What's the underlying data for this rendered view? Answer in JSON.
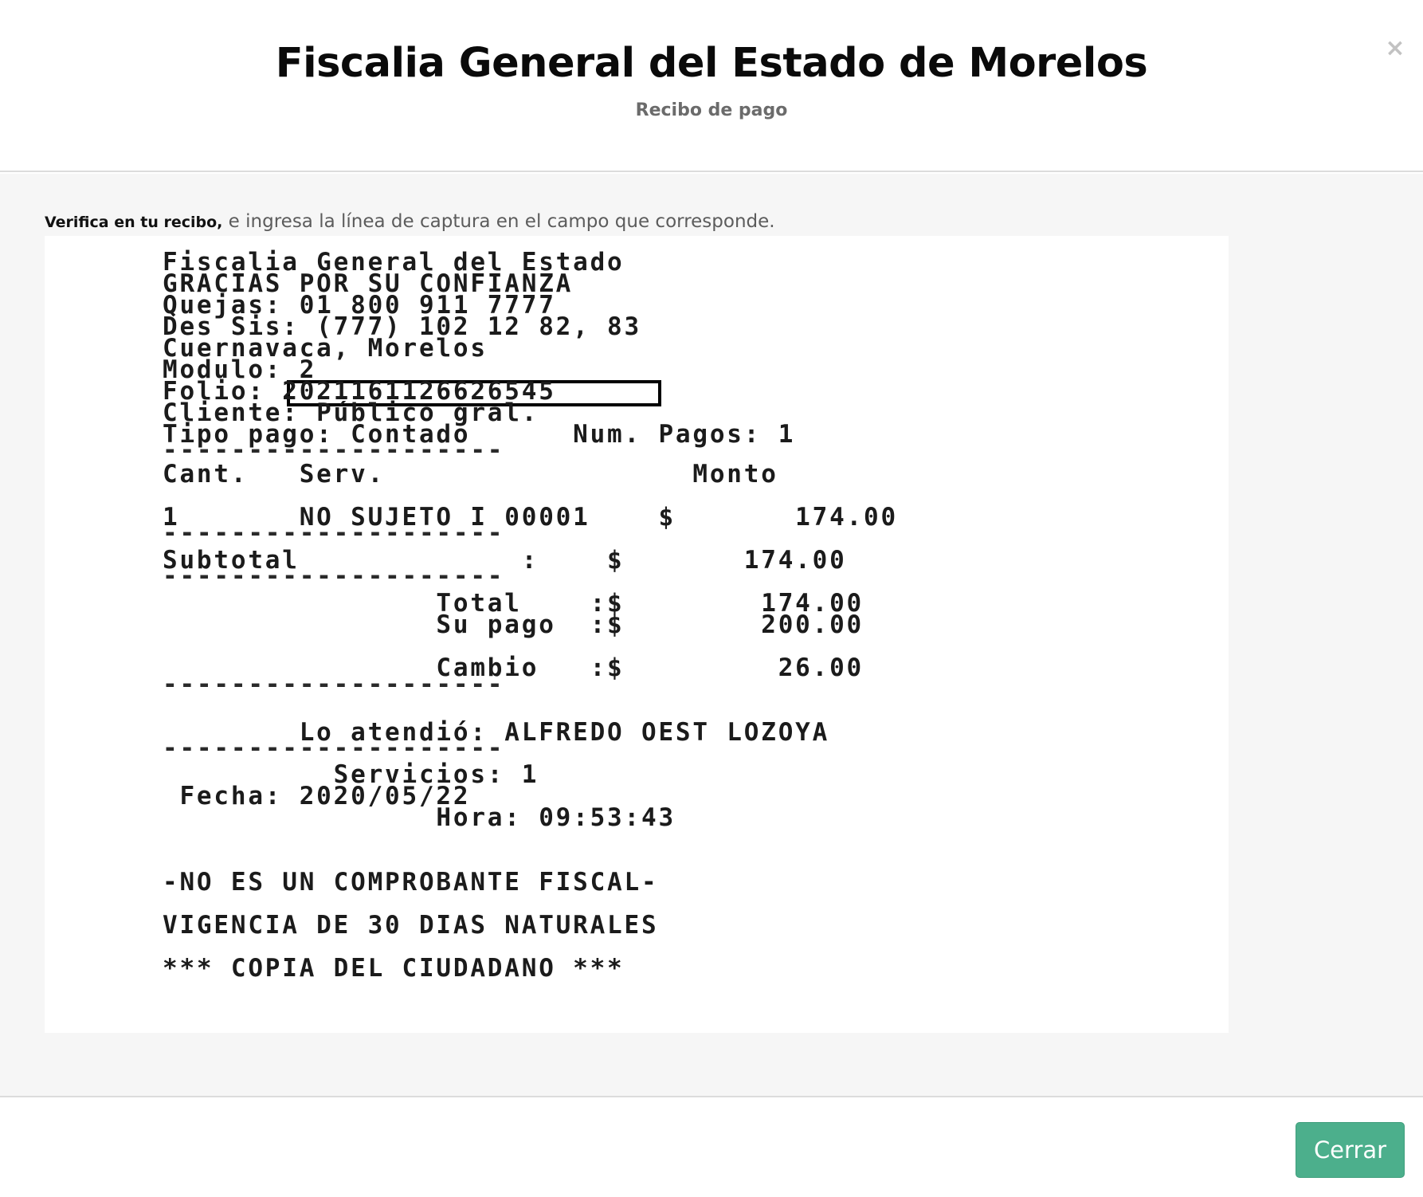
{
  "modal": {
    "title": "Fiscalia General del Estado de Morelos",
    "subtitle": "Recibo de pago",
    "close_icon": "×"
  },
  "body": {
    "instruction_bold": "Verifica en tu recibo,",
    "instruction_rest": " e ingresa la línea de captura en el campo que corresponde."
  },
  "receipt": {
    "lines": [
      "Fiscalia General del Estado",
      "GRACIAS POR SU CONFIANZA",
      "Quejas: 01 800 911 7777",
      "Des Sis: (777) 102 12 82, 83",
      "Cuernavaca, Morelos",
      "Modulo: 2",
      "Folio: 202116112662654​5",
      "Cliente: Público gral.",
      "Tipo pago: Contado      Num. Pagos: 1",
      "--------------------",
      "Cant.   Serv.                  Monto",
      "1       NO SUJETO I 00001    $       174.00",
      "--------------------",
      "Subtotal             :    $       174.00",
      "--------------------",
      "                Total    :$        174.00",
      "                Su pago  :$        200.00",
      "                Cambio   :$         26.00",
      "--------------------",
      "        Lo atendió: ALFREDO OEST LOZOYA",
      "--------------------",
      "          Servicios: 1",
      " Fecha: 2020/05/22",
      "                Hora: 09:53:43",
      "-NO ES UN COMPROBANTE FISCAL-",
      "VIGENCIA DE 30 DIAS NATURALES",
      "*** COPIA DEL CIUDADANO ***"
    ]
  },
  "footer": {
    "close_label": "Cerrar"
  },
  "colors": {
    "accent": "#4caf8c",
    "body_bg": "#f6f6f6",
    "subtitle": "#6b6b6b"
  }
}
